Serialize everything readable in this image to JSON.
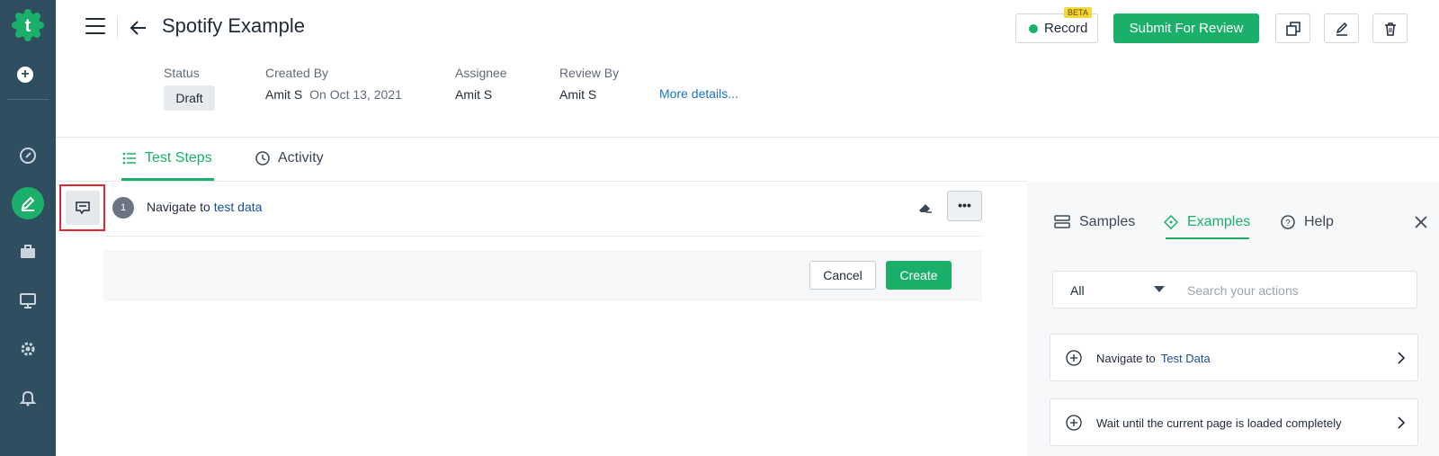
{
  "header": {
    "title": "Spotify Example",
    "record_label": "Record",
    "beta_label": "BETA",
    "submit_label": "Submit For Review"
  },
  "meta": {
    "status_label": "Status",
    "status_value": "Draft",
    "created_by_label": "Created By",
    "created_by_value": "Amit S",
    "created_on": "On Oct 13, 2021",
    "assignee_label": "Assignee",
    "assignee_value": "Amit S",
    "review_by_label": "Review By",
    "review_by_value": "Amit S",
    "more_details": "More details..."
  },
  "tabs": [
    {
      "label": "Test Steps",
      "active": true
    },
    {
      "label": "Activity",
      "active": false
    }
  ],
  "step": {
    "number": "1",
    "prefix": "Navigate to",
    "link": "test data",
    "more": "•••"
  },
  "editor": {
    "cancel_label": "Cancel",
    "create_label": "Create"
  },
  "panel": {
    "tabs": [
      {
        "label": "Samples",
        "active": false
      },
      {
        "label": "Examples",
        "active": true
      },
      {
        "label": "Help",
        "active": false
      }
    ],
    "filter_value": "All",
    "search_placeholder": "Search your actions",
    "cards": [
      {
        "prefix": "Navigate to",
        "link": "Test Data"
      },
      {
        "prefix": "Wait until the current page is loaded completely",
        "link": ""
      }
    ]
  },
  "colors": {
    "accent": "#1ab06a",
    "rail": "#2f4e5f",
    "link": "#1a73c9",
    "highlight": "#e1262d"
  }
}
